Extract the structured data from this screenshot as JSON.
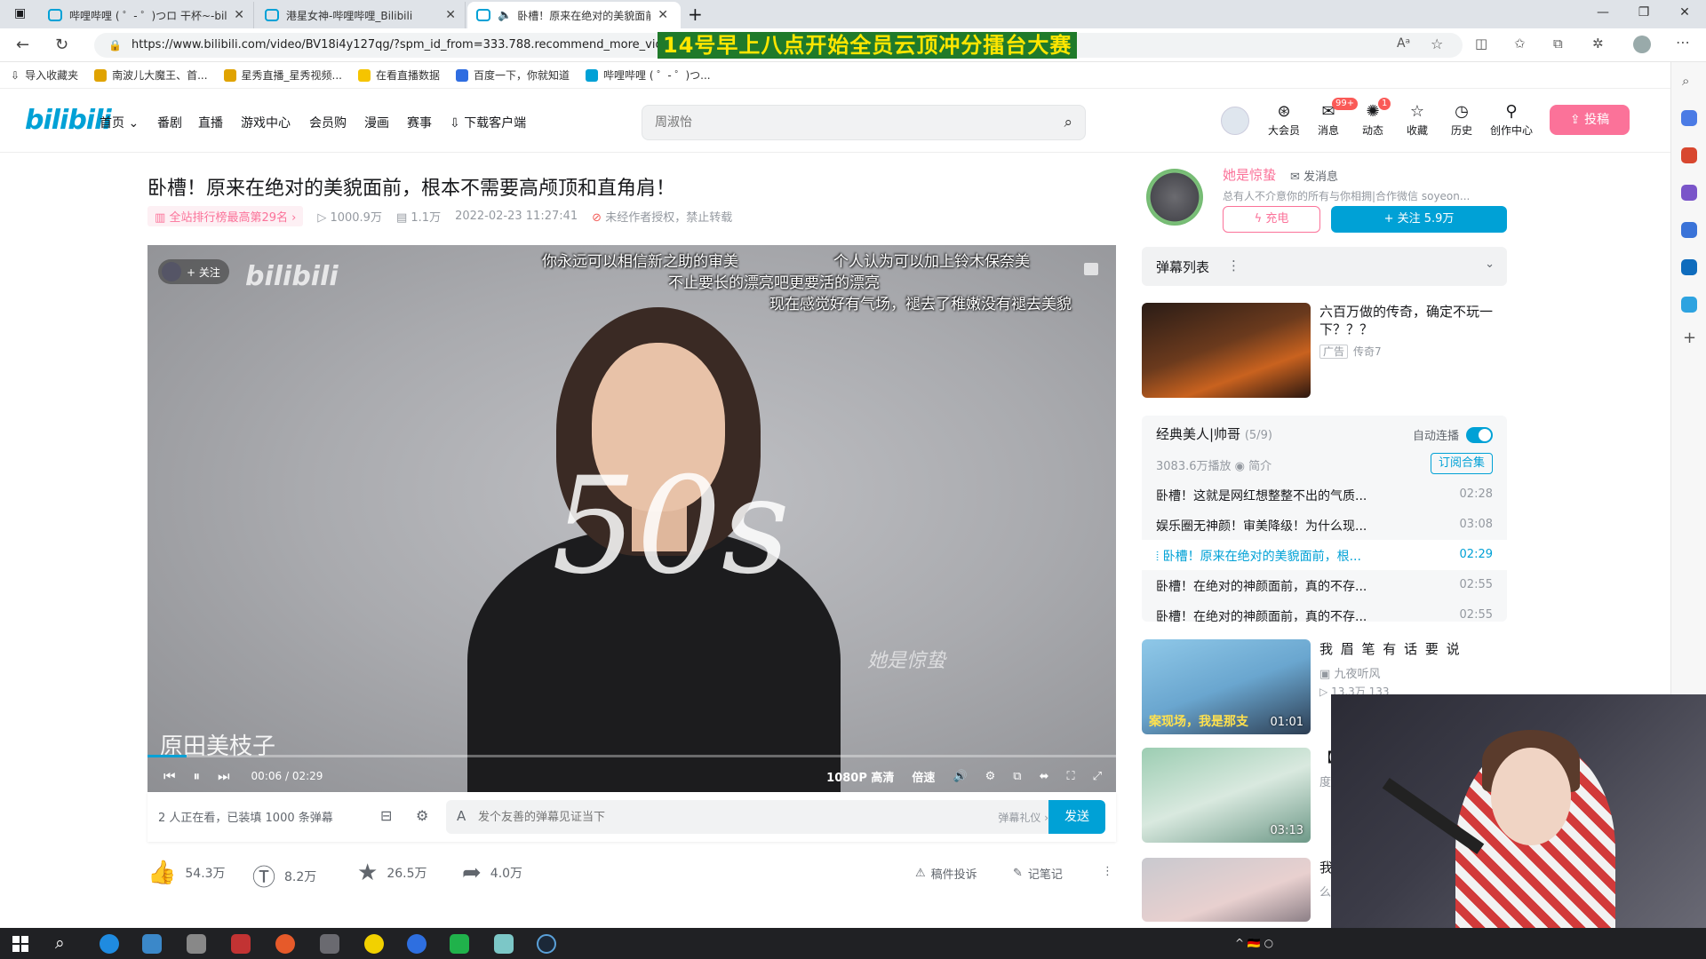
{
  "browser": {
    "tabs": [
      {
        "label": "哔哩哔哩 ( ゜- ゜)つロ 干杯~-bilibili"
      },
      {
        "label": "港星女神-哔哩哔哩_Bilibili"
      },
      {
        "label": "卧槽！原来在绝对的美貌面前"
      }
    ],
    "url": "https://www.bilibili.com/video/BV18i4y127qg/?spm_id_from=333.788.recommend_more_video.",
    "overlay_banner": "14号早上八点开始全员云顶冲分擂台大赛",
    "bookmarks": [
      "导入收藏夹",
      "南波儿大魔王、首...",
      "星秀直播_星秀视频...",
      "在看直播数据",
      "百度一下，你就知道",
      "哔哩哔哩 ( ゜- ゜)つ..."
    ]
  },
  "header": {
    "logo": "bilibili",
    "nav": [
      "首页",
      "番剧",
      "直播",
      "游戏中心",
      "会员购",
      "漫画",
      "赛事",
      "下载客户端"
    ],
    "search_placeholder": "周淑怡",
    "icons": [
      {
        "icon": "vip-icon",
        "label": "大会员"
      },
      {
        "icon": "message-icon",
        "label": "消息",
        "badge": "99+"
      },
      {
        "icon": "dynamic-icon",
        "label": "动态",
        "badge": "1"
      },
      {
        "icon": "favorite-icon",
        "label": "收藏"
      },
      {
        "icon": "history-icon",
        "label": "历史"
      },
      {
        "icon": "creator-icon",
        "label": "创作中心"
      }
    ],
    "upload": "投稿"
  },
  "video": {
    "title": "卧槽！原来在绝对的美貌面前，根本不需要高颅顶和直角肩！",
    "rank": "全站排行榜最高第29名",
    "views": "1000.9万",
    "danmaku_count": "1.1万",
    "date": "2022-02-23 11:27:41",
    "notice": "未经作者授权，禁止转载"
  },
  "player": {
    "logo": "bilibili",
    "follow_chip": "+ 关注",
    "danmaku": [
      "你永远可以相信新之助的审美",
      "个人认为可以加上铃木保奈美",
      "不止要长的漂亮吧更要活的漂亮",
      "现在感觉好有气场，褪去了稚嫩没有褪去美貌"
    ],
    "overlay_text": "50s",
    "signature": "她是惊蛰",
    "caption": "原田美枝子",
    "progress": 0.04,
    "time_current": "00:06",
    "time_total": "02:29",
    "quality": "1080P 高清",
    "speed": "倍速"
  },
  "sendbar": {
    "viewers": "2 人正在看，已装填 1000 条弹幕",
    "placeholder": "发个友善的弹幕见证当下",
    "etiquette": "弹幕礼仪 ›",
    "send": "发送"
  },
  "actions": {
    "like": "54.3万",
    "coin": "8.2万",
    "fav": "26.5万",
    "share": "4.0万",
    "report": "稿件投诉",
    "note": "记笔记"
  },
  "uploader": {
    "name": "她是惊蛰",
    "message": "发消息",
    "sign": "总有人不介意你的所有与你相拥|合作微信 soyeon...",
    "charge": "充电",
    "follow": "+ 关注 5.9万"
  },
  "danmaku_list": {
    "title": "弹幕列表"
  },
  "ad": {
    "title": "六百万做的传奇，确定不玩一下？？？",
    "tag": "广告",
    "source": "传奇7"
  },
  "collection": {
    "title": "经典美人|帅哥",
    "progress": "(5/9)",
    "autoplay": "自动连播",
    "stats": "3083.6万播放",
    "intro": "简介",
    "subscribe": "订阅合集",
    "episodes": [
      {
        "title": "卧槽！这就是网红想整整不出的气质...",
        "dur": "02:28"
      },
      {
        "title": "娱乐圈无神颜！审美降级！为什么现...",
        "dur": "03:08"
      },
      {
        "title": "卧槽！原来在绝对的美貌面前，根...",
        "dur": "02:29"
      },
      {
        "title": "卧槽！在绝对的神颜面前，真的不存...",
        "dur": "02:55"
      },
      {
        "title": "卧槽！在绝对的神颜面前，真的不存...",
        "dur": "02:55"
      }
    ]
  },
  "recommend": [
    {
      "title": "我 眉 笔 有 话 要 说",
      "author": "九夜听风",
      "stats": "13.3万   133",
      "dur": "01:01",
      "overlay": "案现场，我是那支"
    },
    {
      "title": "【晓",
      "author": "度",
      "stats": "",
      "dur": "03:13"
    },
    {
      "title": "我",
      "author": "么",
      "stats": "",
      "dur": ""
    }
  ],
  "taskbar": {
    "tray": "^ 🇩🇪 ○"
  },
  "colors": {
    "accent": "#00a1d6",
    "pink": "#fb7299"
  }
}
